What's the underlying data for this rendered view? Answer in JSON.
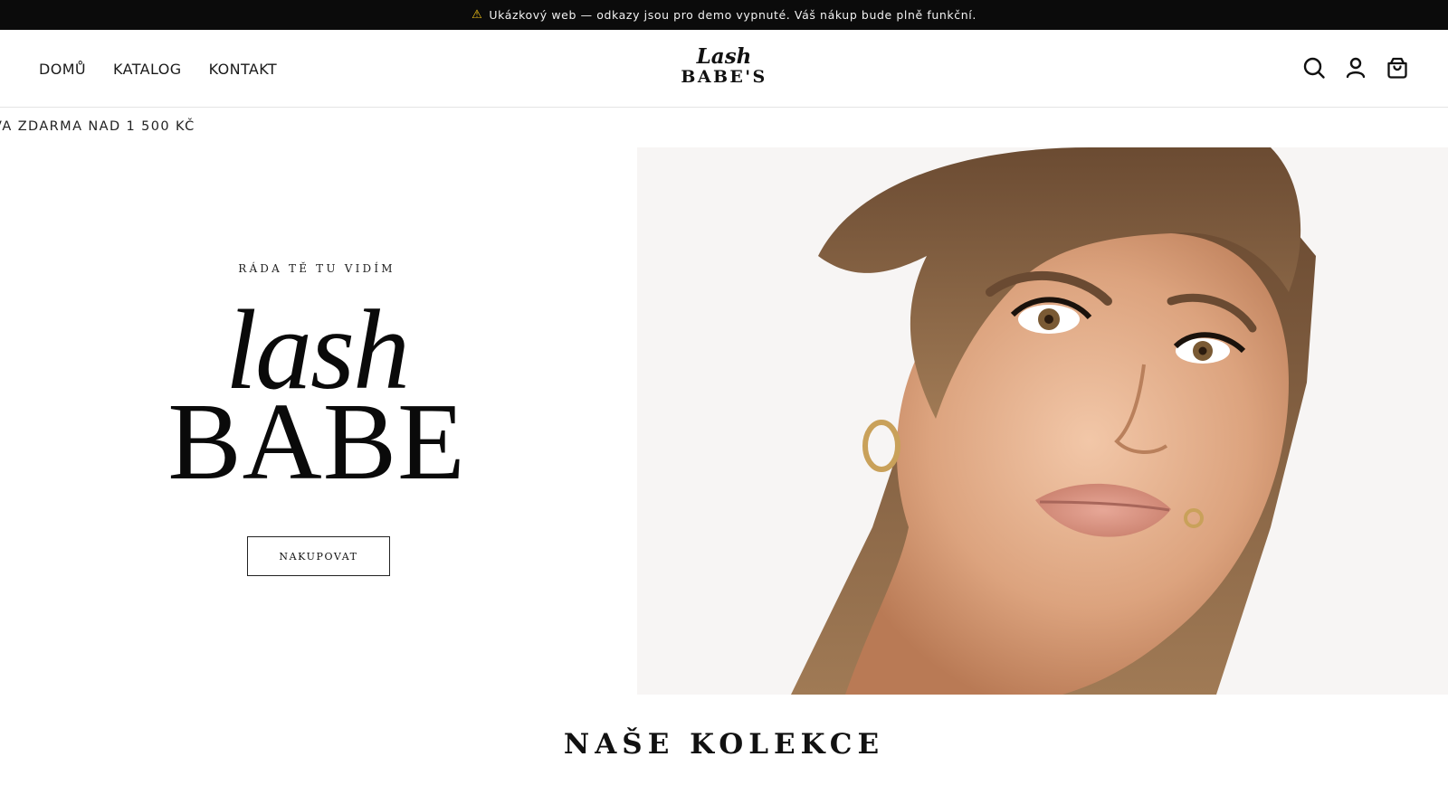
{
  "announcement": {
    "icon": "warning-icon",
    "text": "Ukázkový web — odkazy jsou pro demo vypnuté. Váš nákup bude plně funkční."
  },
  "nav": {
    "items": [
      {
        "label": "DOMŮ"
      },
      {
        "label": "KATALOG"
      },
      {
        "label": "KONTAKT"
      }
    ]
  },
  "logo": {
    "line1": "Lash",
    "line2": "BABE'S"
  },
  "header_icons": [
    "search-icon",
    "account-icon",
    "cart-icon"
  ],
  "ticker": {
    "text": "VA ZDARMA NAD 1 500 KČ"
  },
  "hero": {
    "eyebrow": "RÁDA TĚ TU VIDÍM",
    "title_line1": "lash",
    "title_line2": "BABE",
    "cta_label": "NAKUPOVAT"
  },
  "collections": {
    "title": "NAŠE KOLEKCE"
  },
  "colors": {
    "announcement_bg": "#0b0b0b",
    "text": "#111111",
    "background": "#ffffff"
  }
}
